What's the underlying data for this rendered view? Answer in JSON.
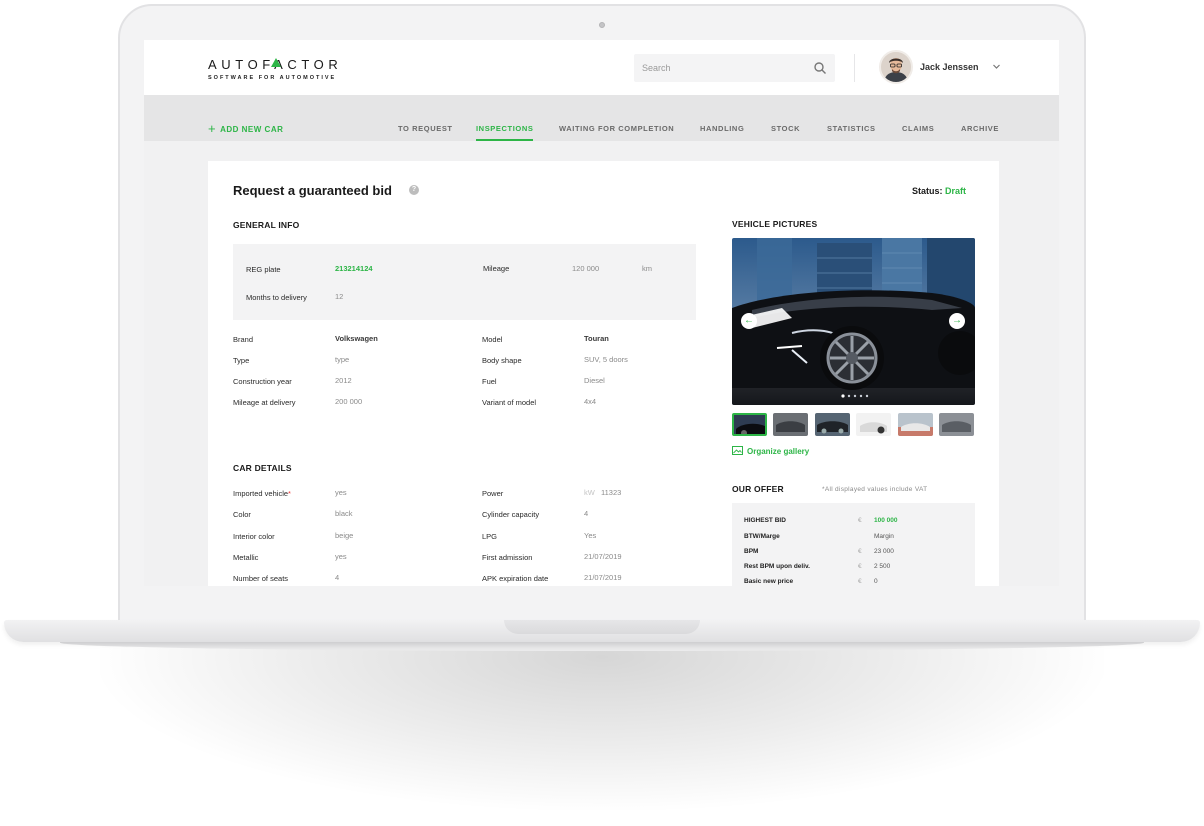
{
  "header": {
    "logo_main": "AUTOFACTOR",
    "logo_sub": "SOFTWARE FOR AUTOMOTIVE",
    "search_placeholder": "Search",
    "user_name": "Jack Jenssen"
  },
  "nav": {
    "add_new_car": "ADD NEW CAR",
    "tabs": [
      {
        "label": "TO REQUEST"
      },
      {
        "label": "INSPECTIONS",
        "active": true
      },
      {
        "label": "WAITING FOR COMPLETION"
      },
      {
        "label": "HANDLING"
      },
      {
        "label": "STOCK"
      },
      {
        "label": "STATISTICS"
      },
      {
        "label": "CLAIMS"
      },
      {
        "label": "ARCHIVE"
      }
    ]
  },
  "page": {
    "title": "Request a guaranteed bid",
    "status_label": "Status:",
    "status_value": "Draft"
  },
  "general_info": {
    "title": "GENERAL INFO",
    "reg_plate_label": "REG plate",
    "reg_plate_value": "213214124",
    "mileage_label": "Mileage",
    "mileage_value": "120 000",
    "mileage_unit": "km",
    "months_label": "Months to delivery",
    "months_value": "12",
    "left": [
      {
        "label": "Brand",
        "value": "Volkswagen"
      },
      {
        "label": "Type",
        "value": "type"
      },
      {
        "label": "Construction year",
        "value": "2012"
      },
      {
        "label": "Mileage at delivery",
        "value": "200 000"
      }
    ],
    "right": [
      {
        "label": "Model",
        "value": "Touran"
      },
      {
        "label": "Body shape",
        "value": "SUV, 5 doors"
      },
      {
        "label": "Fuel",
        "value": "Diesel"
      },
      {
        "label": "Variant of model",
        "value": "4x4"
      }
    ]
  },
  "car_details": {
    "title": "CAR DETAILS",
    "left": [
      {
        "label": "Imported vehicle",
        "value": "yes"
      },
      {
        "label": "Color",
        "value": "black"
      },
      {
        "label": "Interior color",
        "value": "beige"
      },
      {
        "label": "Metallic",
        "value": "yes"
      },
      {
        "label": "Number of seats",
        "value": "4"
      }
    ],
    "power_unit": "kW",
    "right": [
      {
        "label": "Power",
        "value": "11323"
      },
      {
        "label": "Cylinder capacity",
        "value": "4"
      },
      {
        "label": "LPG",
        "value": "Yes"
      },
      {
        "label": "First admission",
        "value": "21/07/2019"
      },
      {
        "label": "APK expiration date",
        "value": "21/07/2019"
      }
    ]
  },
  "vehicle_pictures": {
    "title": "VEHICLE PICTURES",
    "organize_label": "Organize gallery"
  },
  "offer": {
    "title": "OUR OFFER",
    "note": "*All displayed values include VAT",
    "rows": [
      {
        "label": "HIGHEST BID",
        "currency": "€",
        "value": "100 000"
      },
      {
        "label": "BTW/Marge",
        "currency": "",
        "value": "Margin"
      },
      {
        "label": "BPM",
        "currency": "€",
        "value": "23 000"
      },
      {
        "label": "Rest BPM upon deliv.",
        "currency": "€",
        "value": "2 500"
      },
      {
        "label": "Basic new price",
        "currency": "€",
        "value": "0"
      }
    ]
  },
  "colors": {
    "accent": "#2db547"
  }
}
